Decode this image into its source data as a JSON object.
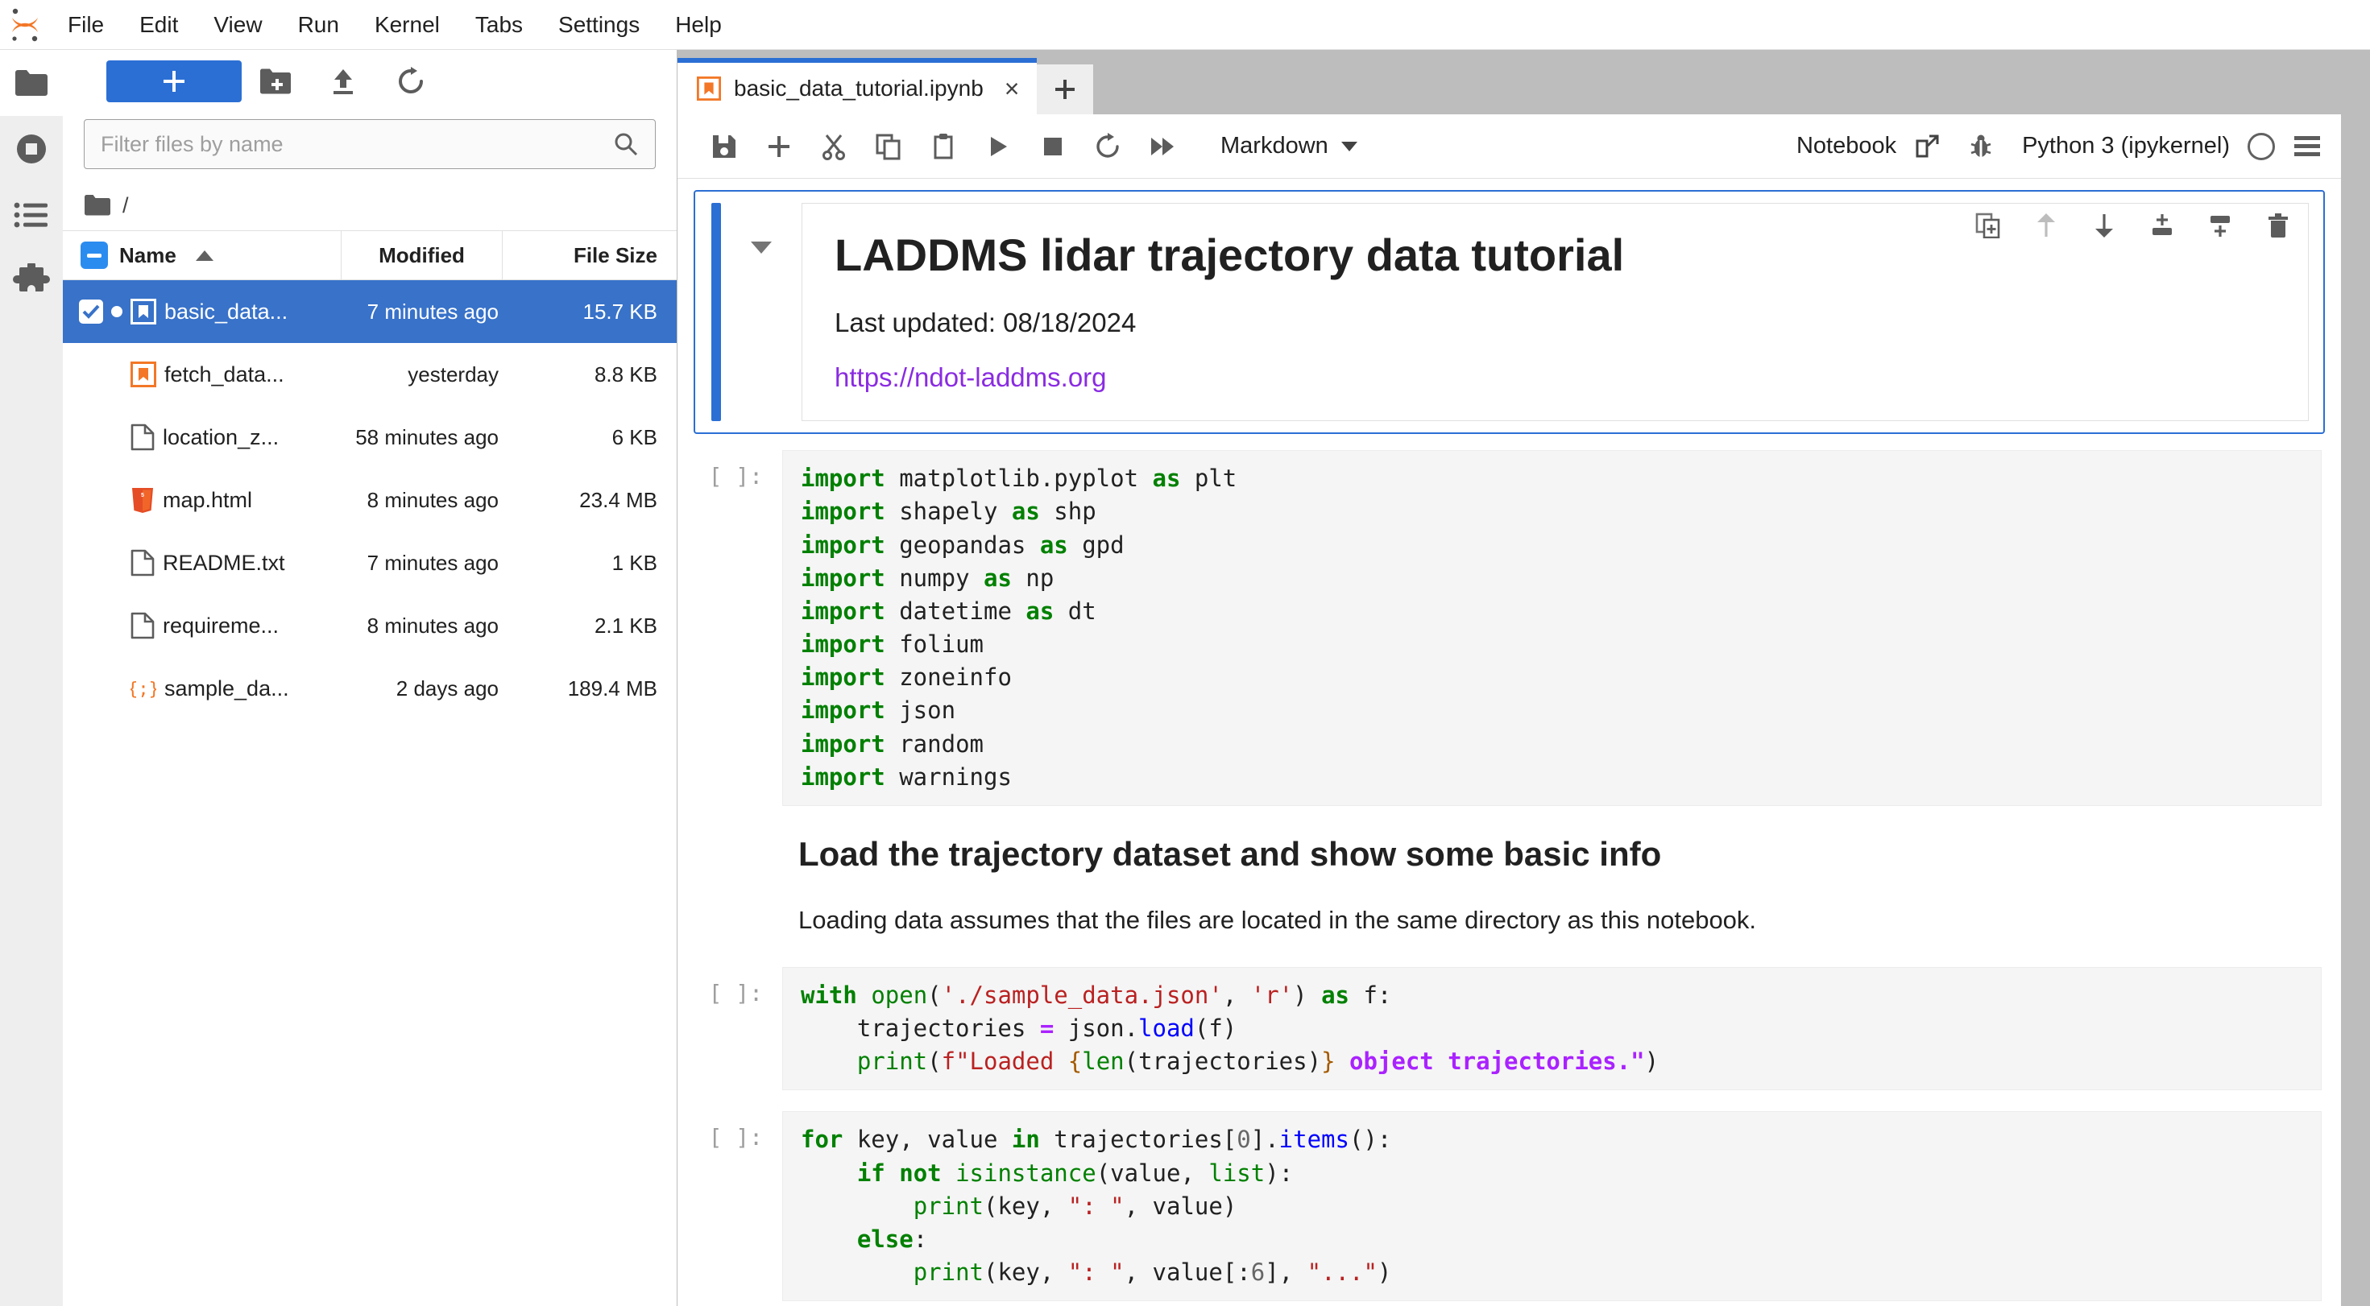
{
  "app": {
    "title": "JupyterLab",
    "logo_icon": "jupyter-logo"
  },
  "menubar": {
    "items": [
      {
        "label": "File"
      },
      {
        "label": "Edit"
      },
      {
        "label": "View"
      },
      {
        "label": "Run"
      },
      {
        "label": "Kernel"
      },
      {
        "label": "Tabs"
      },
      {
        "label": "Settings"
      },
      {
        "label": "Help"
      }
    ]
  },
  "activitybar": {
    "items": [
      {
        "name": "file-browser",
        "icon": "folder-icon",
        "active": true
      },
      {
        "name": "running-sessions",
        "icon": "stop-circle-icon",
        "active": false
      },
      {
        "name": "table-of-contents",
        "icon": "list-icon",
        "active": false
      },
      {
        "name": "extension-manager",
        "icon": "puzzle-icon",
        "active": false
      }
    ]
  },
  "filebrowser": {
    "toolbar": {
      "new_launcher_label": "+",
      "new_folder_icon": "new-folder-icon",
      "upload_icon": "upload-icon",
      "refresh_icon": "refresh-icon"
    },
    "filter": {
      "placeholder": "Filter files by name",
      "value": "",
      "search_icon": "search-icon"
    },
    "breadcrumb": {
      "root_icon": "folder-icon",
      "path": "/"
    },
    "columns": {
      "name": "Name",
      "modified": "Modified",
      "size": "File Size"
    },
    "sort": {
      "column": "Name",
      "direction": "ascending"
    },
    "files": [
      {
        "name": "basic_data...",
        "modified": "7 minutes ago",
        "size": "15.7 KB",
        "icon": "notebook-icon",
        "selected": true,
        "checked": true,
        "dirty": true
      },
      {
        "name": "fetch_data...",
        "modified": "yesterday",
        "size": "8.8 KB",
        "icon": "notebook-icon",
        "selected": false,
        "checked": false,
        "dirty": false
      },
      {
        "name": "location_z...",
        "modified": "58 minutes ago",
        "size": "6 KB",
        "icon": "file-icon",
        "selected": false,
        "checked": false,
        "dirty": false
      },
      {
        "name": "map.html",
        "modified": "8 minutes ago",
        "size": "23.4 MB",
        "icon": "html5-icon",
        "selected": false,
        "checked": false,
        "dirty": false
      },
      {
        "name": "README.txt",
        "modified": "7 minutes ago",
        "size": "1 KB",
        "icon": "file-icon",
        "selected": false,
        "checked": false,
        "dirty": false
      },
      {
        "name": "requireme...",
        "modified": "8 minutes ago",
        "size": "2.1 KB",
        "icon": "file-icon",
        "selected": false,
        "checked": false,
        "dirty": false
      },
      {
        "name": "sample_da...",
        "modified": "2 days ago",
        "size": "189.4 MB",
        "icon": "json-icon",
        "selected": false,
        "checked": false,
        "dirty": false
      }
    ]
  },
  "notebook": {
    "tab": {
      "label": "basic_data_tutorial.ipynb",
      "icon": "notebook-icon",
      "close_label": "×"
    },
    "add_tab_label": "+",
    "toolbar": {
      "buttons": [
        {
          "name": "save-button",
          "icon": "save-icon"
        },
        {
          "name": "insert-cell-button",
          "icon": "plus-icon"
        },
        {
          "name": "cut-cell-button",
          "icon": "scissors-icon"
        },
        {
          "name": "copy-cell-button",
          "icon": "copy-icon"
        },
        {
          "name": "paste-cell-button",
          "icon": "paste-icon"
        },
        {
          "name": "run-cell-button",
          "icon": "play-icon"
        },
        {
          "name": "interrupt-kernel-button",
          "icon": "stop-icon"
        },
        {
          "name": "restart-kernel-button",
          "icon": "restart-icon"
        },
        {
          "name": "restart-run-all-button",
          "icon": "fast-forward-icon"
        }
      ],
      "cell_type": "Markdown",
      "notebook_label": "Notebook",
      "launch_icon": "external-link-icon",
      "debugger_icon": "bug-icon",
      "kernel_name": "Python 3 (ipykernel)",
      "kernel_status_icon": "idle-circle-icon",
      "menu_icon": "hamburger-icon"
    },
    "cell_toolbar": [
      {
        "name": "duplicate-cell-button",
        "icon": "duplicate-icon",
        "disabled": false
      },
      {
        "name": "move-cell-up-button",
        "icon": "arrow-up-icon",
        "disabled": true
      },
      {
        "name": "move-cell-down-button",
        "icon": "arrow-down-icon",
        "disabled": false
      },
      {
        "name": "insert-cell-above-button",
        "icon": "insert-above-icon",
        "disabled": false
      },
      {
        "name": "insert-cell-below-button",
        "icon": "insert-below-icon",
        "disabled": false
      },
      {
        "name": "delete-cell-button",
        "icon": "trash-icon",
        "disabled": false
      }
    ],
    "cells": {
      "markdown_title": {
        "heading": "LADDMS lidar trajectory data tutorial",
        "last_updated": "Last updated: 08/18/2024",
        "link_text": "https://ndot-laddms.org"
      },
      "code_imports": {
        "prompt": "[ ]:"
      },
      "markdown_section": {
        "heading": "Load the trajectory dataset and show some basic info",
        "paragraph": "Loading data assumes that the files are located in the same directory as this notebook."
      },
      "code_load": {
        "prompt": "[ ]:"
      },
      "code_iterate": {
        "prompt": "[ ]:"
      }
    }
  },
  "colors": {
    "accent_blue": "#2b6fd4",
    "selection_blue": "#3872c9",
    "link_purple": "#8a2be2",
    "jupyter_orange": "#f37726",
    "code_bg": "#f5f5f5",
    "chrome_gray": "#bdbdbd"
  }
}
